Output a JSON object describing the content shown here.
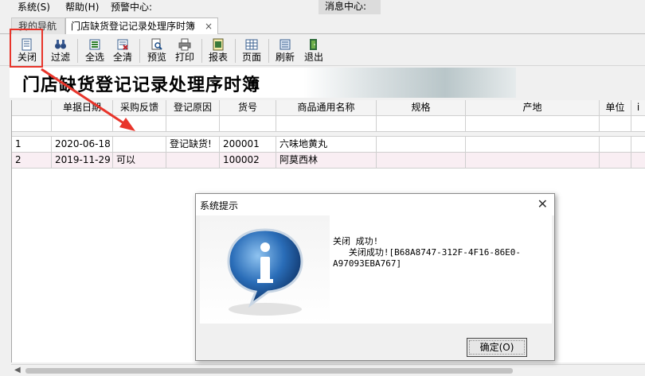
{
  "menubar": {
    "items": [
      "系统(S)",
      "帮助(H)",
      "预警中心:"
    ],
    "message_center": "消息中心:"
  },
  "tabs": [
    {
      "label": "我的导航"
    },
    {
      "label": "门店缺货登记记录处理序时簿",
      "close": "×"
    }
  ],
  "toolbar": {
    "buttons": [
      "关闭",
      "过滤",
      "全选",
      "全清",
      "预览",
      "打印",
      "报表",
      "页面",
      "刷新",
      "退出"
    ]
  },
  "banner": {
    "title": "门店缺货登记记录处理序时簿"
  },
  "grid": {
    "columns": [
      "",
      "单据日期",
      "采购反馈",
      "登记原因",
      "货号",
      "商品通用名称",
      "规格",
      "产地",
      "单位",
      "i"
    ],
    "rows": [
      [
        "1",
        "2020-06-18",
        "",
        "登记缺货!",
        "200001",
        "六味地黄丸",
        "",
        "",
        "",
        ""
      ],
      [
        "2",
        "2019-11-29",
        "可以",
        "",
        "100002",
        "阿莫西林",
        "",
        "",
        "",
        ""
      ]
    ]
  },
  "dialog": {
    "title": "系统提示",
    "close": "✕",
    "message_line1": "关闭 成功!",
    "message_line2": "   关闭成功![B68A8747-312F-4F16-86E0-",
    "message_line3": "A97093EBA767]",
    "ok_label": "确定(O)"
  },
  "colors": {
    "highlight": "#e8342a",
    "row_alt": "#f9eef3",
    "info_icon": "#1f5fa8"
  }
}
